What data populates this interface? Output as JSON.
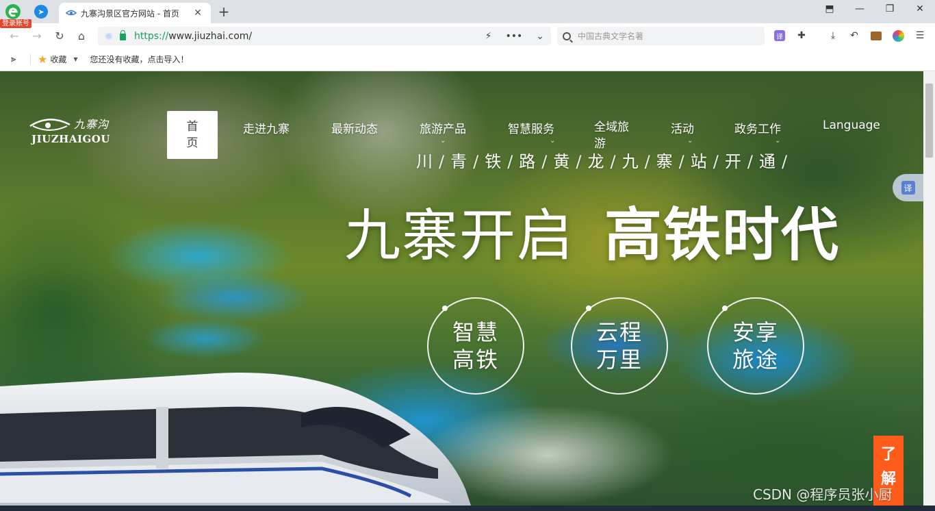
{
  "browser": {
    "login_badge": "登录账号",
    "tab": {
      "title": "九寨沟景区官方网站 - 首页",
      "close": "✕"
    },
    "new_tab": "+",
    "window_controls": {
      "pin": "⬒",
      "minimize": "—",
      "maximize": "❐",
      "close": "✕"
    },
    "nav": {
      "back": "←",
      "forward": "→",
      "reload": "↻",
      "home": "⌂"
    },
    "address": {
      "scheme": "https://",
      "rest": "www.jiuzhai.com/"
    },
    "omnibox_icons": {
      "flash": "⚡",
      "more": "•••",
      "dropdown": "⌄"
    },
    "search": {
      "placeholder": "中国古典文学名著"
    },
    "toolbar_icons": {
      "translate": "译",
      "extensions": "✚",
      "download": "⤓",
      "undo": "↶",
      "menu": "☰"
    },
    "bookmarks": {
      "favorites": "收藏",
      "caret": "▼",
      "hint": "您还没有收藏，点击导入！",
      "sidebar": "⫸"
    },
    "colors": {
      "tab_strip": "#dee1e6",
      "secure_green": "#19a15f",
      "badge_red": "#e8452c"
    }
  },
  "site": {
    "logo": {
      "cn": "九寨沟",
      "en": "JIUZHAIGOU"
    },
    "nav": [
      {
        "label": "首页",
        "active": true
      },
      {
        "label": "走进九寨"
      },
      {
        "label": "最新动态"
      },
      {
        "label": "旅游产品"
      },
      {
        "label": "智慧服务"
      },
      {
        "label": "全域旅游"
      },
      {
        "label": "活动"
      },
      {
        "label": "政务工作"
      },
      {
        "label": "Language"
      }
    ],
    "hero": {
      "subtitle_chars": [
        "川",
        "青",
        "铁",
        "路",
        "黄",
        "龙",
        "九",
        "寨",
        "站",
        "开",
        "通"
      ],
      "subtitle_separator": "/",
      "title_thin": "九寨开启",
      "title_bold": "高铁时代",
      "bubbles": [
        {
          "line1": "智慧",
          "line2": "高铁"
        },
        {
          "line1": "云程",
          "line2": "万里"
        },
        {
          "line1": "安享",
          "line2": "旅途"
        }
      ]
    },
    "float_translate": "译",
    "learn_more": [
      "了",
      "解"
    ],
    "watermark": "CSDN @程序员张小厨",
    "colors": {
      "accent_orange": "#ff5b1a",
      "white": "#ffffff"
    }
  }
}
